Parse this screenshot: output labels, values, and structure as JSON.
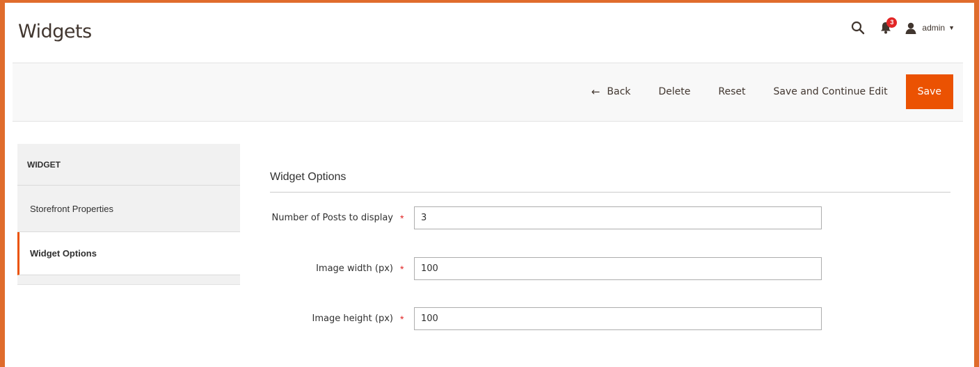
{
  "page": {
    "title": "Widgets"
  },
  "header": {
    "notifications_count": "3",
    "user_name": "admin",
    "icons": [
      "search-icon",
      "bell-icon",
      "user-icon",
      "caret-down-icon"
    ]
  },
  "actions": {
    "back": "Back",
    "delete": "Delete",
    "reset": "Reset",
    "save_continue": "Save and Continue Edit",
    "save": "Save"
  },
  "sidebar": {
    "title": "WIDGET",
    "items": [
      {
        "label": "Storefront Properties",
        "active": false
      },
      {
        "label": "Widget Options",
        "active": true
      }
    ]
  },
  "form": {
    "section_title": "Widget Options",
    "fields": [
      {
        "label": "Number of Posts to display",
        "value": "3",
        "required": true
      },
      {
        "label": "Image width (px)",
        "value": "100",
        "required": true
      },
      {
        "label": "Image height (px)",
        "value": "100",
        "required": true
      }
    ]
  },
  "colors": {
    "accent": "#eb5202",
    "frame": "#e06c2c",
    "required": "#e22626",
    "text": "#303030"
  }
}
